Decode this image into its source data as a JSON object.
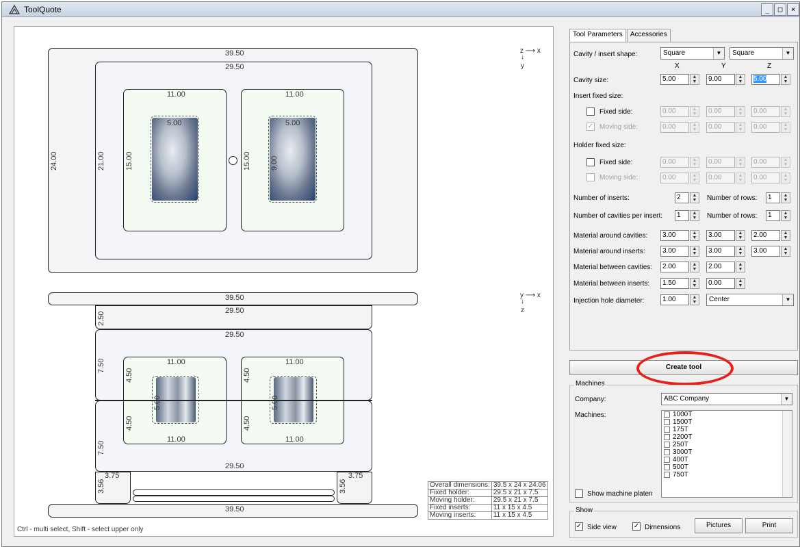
{
  "window": {
    "title": "ToolQuote",
    "controls": [
      "_",
      "□",
      "×"
    ]
  },
  "canvas": {
    "top_view": {
      "axis": {
        "h": "z ⟶ x",
        "v": "y"
      },
      "outer_width": "39.50",
      "outer_height": "24.00",
      "holder_width": "29.50",
      "holder_height": "21.00",
      "insert_left_width": "11.00",
      "insert_right_width": "11.00",
      "insert_left_height": "15.00",
      "insert_right_height": "15.00",
      "cavity_left_top": "5.00",
      "cavity_right_top": "5.00",
      "cavity_right_side": "9.00"
    },
    "side_view": {
      "axis": {
        "h": "y ⟶ x",
        "v": "z"
      },
      "top_plate": "39.50",
      "fixed_clamp": "29.50",
      "fixed_clamp_h": "2.50",
      "fixed_holder": "29.50",
      "fixed_holder_h": "7.50",
      "fixed_insert_left": "11.00",
      "fixed_insert_right": "11.00",
      "fixed_insert_h_left": "4.50",
      "fixed_insert_h_right": "4.50",
      "moving_insert_h_left": "4.50",
      "moving_insert_h_right": "4.50",
      "cavity_h_left": "5.00",
      "cavity_h_right": "5.00",
      "moving_insert_left": "11.00",
      "moving_insert_right": "11.00",
      "moving_holder_h": "7.50",
      "moving_holder": "29.50",
      "rail_left": "3.75",
      "rail_right": "3.75",
      "rail_h_left": "3.56",
      "rail_h_right": "3.56",
      "bottom_plate": "39.50"
    },
    "hint": "Ctrl - multi select,  Shift - select upper only",
    "summary": [
      {
        "label": "Overall dimensions:",
        "value": "39.5 x 24 x 24.06"
      },
      {
        "label": "Fixed holder:",
        "value": "29.5 x 21 x 7.5"
      },
      {
        "label": "Moving holder:",
        "value": "29.5 x 21 x 7.5"
      },
      {
        "label": "Fixed inserts:",
        "value": "11 x 15 x 4.5"
      },
      {
        "label": "Moving inserts:",
        "value": "11 x 15 x 4.5"
      }
    ]
  },
  "tabs": [
    "Tool Parameters",
    "Accessories"
  ],
  "params": {
    "cavity_shape_label": "Cavity / insert shape:",
    "cavity_shape_a": "Square",
    "cavity_shape_b": "Square",
    "col_x": "X",
    "col_y": "Y",
    "col_z": "Z",
    "cavity_size_label": "Cavity size:",
    "cavity_size": [
      "5.00",
      "9.00",
      "5.00"
    ],
    "insert_fixed_label": "Insert fixed size:",
    "fixed_side_label": "Fixed side:",
    "moving_side_label": "Moving side:",
    "insert_fixed": [
      "0.00",
      "0.00",
      "0.00"
    ],
    "insert_moving": [
      "0.00",
      "0.00",
      "0.00"
    ],
    "holder_fixed_label": "Holder fixed size:",
    "holder_fixed": [
      "0.00",
      "0.00",
      "0.00"
    ],
    "holder_moving": [
      "0.00",
      "0.00",
      "0.00"
    ],
    "num_inserts_label": "Number of inserts:",
    "num_inserts": "2",
    "num_rows_label": "Number of rows:",
    "num_rows_a": "1",
    "cav_per_insert_label": "Number of cavities per insert:",
    "cav_per_insert": "1",
    "num_rows_b": "1",
    "mat_cavities_label": "Material around cavities:",
    "mat_cavities": [
      "3.00",
      "3.00",
      "2.00"
    ],
    "mat_inserts_label": "Material around inserts:",
    "mat_inserts": [
      "3.00",
      "3.00",
      "3.00"
    ],
    "mat_between_cav_label": "Material between cavities:",
    "mat_between_cav": [
      "2.00",
      "2.00"
    ],
    "mat_between_ins_label": "Material between inserts:",
    "mat_between_ins": [
      "1.50",
      "0.00"
    ],
    "inj_label": "Injection hole diameter:",
    "inj_value": "1.00",
    "inj_pos": "Center"
  },
  "create_tool": "Create tool",
  "machines": {
    "group": "Machines",
    "company_label": "Company:",
    "company": "ABC Company",
    "machines_label": "Machines:",
    "list": [
      "1000T",
      "1500T",
      "175T",
      "2200T",
      "250T",
      "3000T",
      "400T",
      "500T",
      "750T"
    ],
    "show_platen": "Show machine platen"
  },
  "show": {
    "group": "Show",
    "side_view": "Side view",
    "dimensions": "Dimensions",
    "pictures": "Pictures",
    "print": "Print"
  }
}
